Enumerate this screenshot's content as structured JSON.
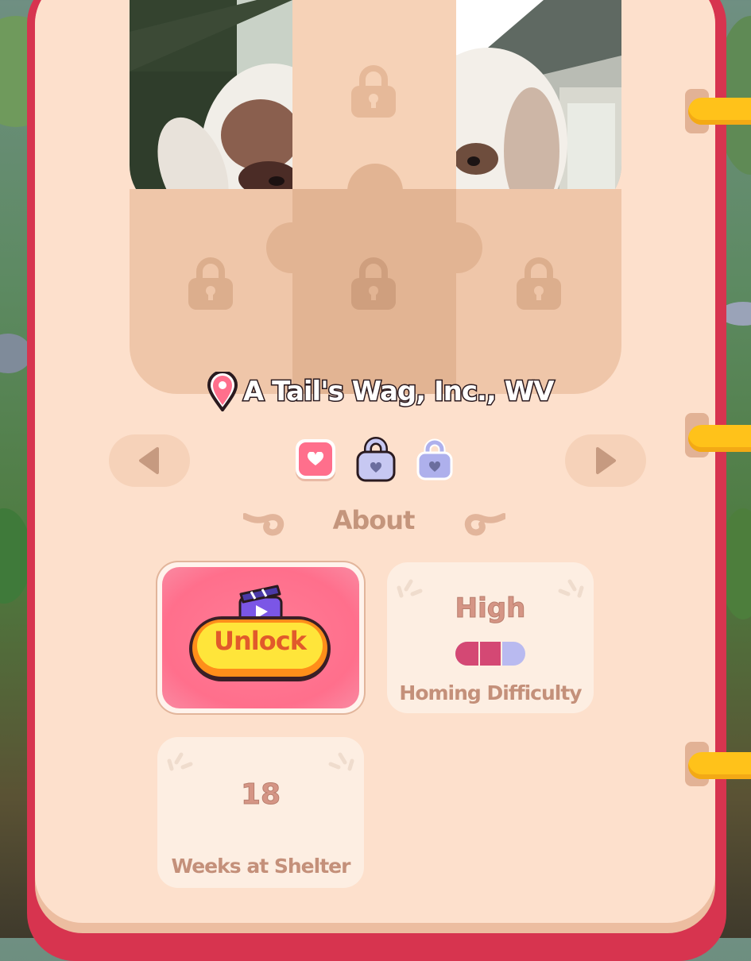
{
  "location": {
    "name": "A Tail's Wag, Inc., WV"
  },
  "photo_pieces": {
    "unlocked_count": 2,
    "locked_count": 4
  },
  "pager": {
    "pages": [
      {
        "state": "unlocked",
        "icon": "heart-icon"
      },
      {
        "state": "current-locked",
        "icon": "padlock-heart-icon"
      },
      {
        "state": "locked",
        "icon": "padlock-heart-icon"
      }
    ]
  },
  "about": {
    "title": "About"
  },
  "unlock": {
    "label": "Unlock",
    "icon": "clapperboard-play-icon"
  },
  "difficulty": {
    "value": "High",
    "caption": "Homing Difficulty",
    "level_filled": 2,
    "level_total": 3
  },
  "shelter": {
    "value": "18",
    "caption": "Weeks at Shelter"
  },
  "colors": {
    "page": "#fde0cc",
    "book_edge": "#d7344f",
    "accent_pink": "#ff6f8c",
    "ring": "#ffc21a",
    "lock_purple": "#aeb0ec",
    "text_brown": "#c4907a"
  }
}
